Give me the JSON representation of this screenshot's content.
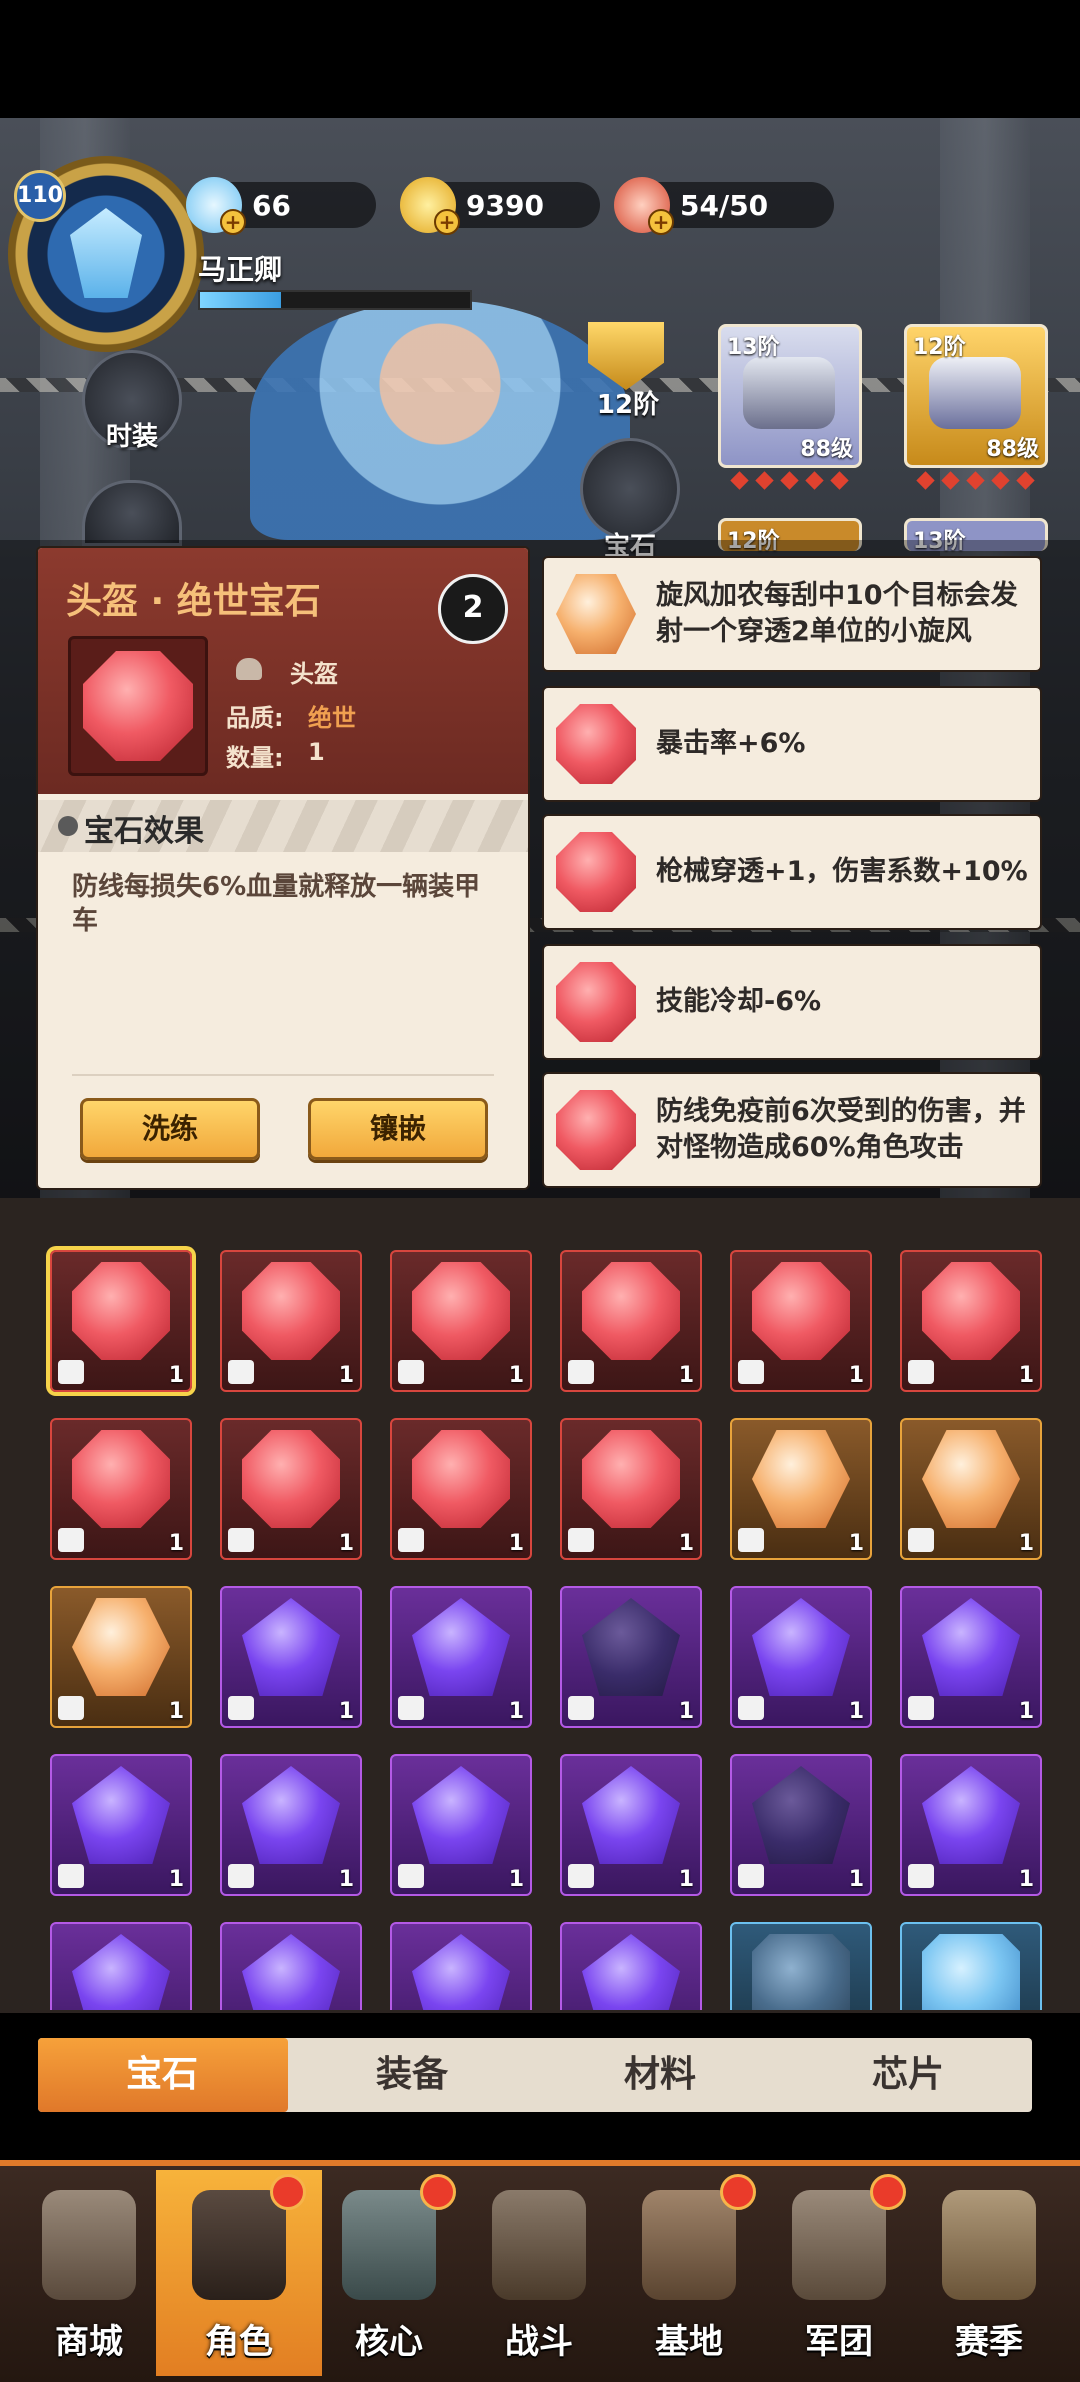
{
  "topbar": {
    "level": "110",
    "player_name": "马正卿",
    "diamonds": "66",
    "coins": "9390",
    "stamina": "54/50"
  },
  "side_buttons": [
    {
      "label": "时装",
      "icon": "outfit-icon"
    },
    {
      "label": "宝石",
      "icon": "list-icon"
    }
  ],
  "rank_badge": {
    "label": "12阶",
    "icon": "shield-rank-icon"
  },
  "equipment": [
    {
      "tier": "13阶",
      "level": "88级",
      "stars": 5,
      "icon": "helmet-equip-icon"
    },
    {
      "tier": "12阶",
      "level": "88级",
      "stars": 5,
      "icon": "armor-equip-icon"
    },
    {
      "tier": "12阶",
      "icon": "equip-icon"
    },
    {
      "tier": "13阶",
      "icon": "equip-icon"
    }
  ],
  "detail": {
    "title": "头盔 · 绝世宝石",
    "slot_label": "头盔",
    "quality_label": "品质:",
    "quality_value": "绝世",
    "count_label": "数量:",
    "count_value": "1",
    "effect_title": "宝石效果",
    "effect_text": "防线每损失6%血量就释放一辆装甲车",
    "btn_reroll": "洗练",
    "btn_inlay": "镶嵌",
    "lock_value": "2",
    "colors": {
      "header": "#8c3a2e",
      "title": "#f6c07a",
      "quality": "#f0a050"
    }
  },
  "effects": [
    {
      "text": "旋风加农每刮中10个目标会发射一个穿透2单位的小旋风",
      "gem": "orange"
    },
    {
      "text": "暴击率+6%",
      "gem": "red"
    },
    {
      "text": "枪械穿透+1，伤害系数+10%",
      "gem": "red"
    },
    {
      "text": "技能冷却-6%",
      "gem": "red"
    },
    {
      "text": "防线免疫前6次受到的伤害，并对怪物造成60%角色攻击",
      "gem": "red"
    }
  ],
  "inventory": [
    {
      "gem": "red",
      "slot": "helmet-icon",
      "count": "1",
      "selected": true
    },
    {
      "gem": "red",
      "slot": "helmet-icon",
      "count": "1"
    },
    {
      "gem": "red",
      "slot": "armor-icon",
      "count": "1"
    },
    {
      "gem": "red",
      "slot": "armor-icon",
      "count": "1"
    },
    {
      "gem": "red",
      "slot": "armor-icon",
      "count": "1"
    },
    {
      "gem": "red",
      "slot": "gun-icon",
      "count": "1"
    },
    {
      "gem": "red",
      "slot": "gun-icon",
      "count": "1"
    },
    {
      "gem": "red",
      "slot": "pants-icon",
      "count": "1"
    },
    {
      "gem": "red",
      "slot": "pants-icon",
      "count": "1"
    },
    {
      "gem": "red",
      "slot": "glove-icon",
      "count": "1"
    },
    {
      "gem": "orange",
      "slot": "armor-icon",
      "count": "1"
    },
    {
      "gem": "orange",
      "slot": "boot-icon",
      "count": "1"
    },
    {
      "gem": "orange",
      "slot": "gun-icon",
      "count": "1"
    },
    {
      "gem": "purple",
      "slot": "helmet-icon",
      "count": "1"
    },
    {
      "gem": "purple",
      "slot": "helmet-icon",
      "count": "1"
    },
    {
      "gem": "dark",
      "slot": "helmet-icon",
      "count": "1"
    },
    {
      "gem": "purple",
      "slot": "helmet-icon",
      "count": "1"
    },
    {
      "gem": "purple",
      "slot": "armor-icon",
      "count": "1"
    },
    {
      "gem": "purple",
      "slot": "boot-icon",
      "count": "1"
    },
    {
      "gem": "purple",
      "slot": "boot-icon",
      "count": "1"
    },
    {
      "gem": "purple",
      "slot": "boot-icon",
      "count": "1"
    },
    {
      "gem": "purple",
      "slot": "gun-icon",
      "count": "1"
    },
    {
      "gem": "dark",
      "slot": "gun-icon",
      "count": "1"
    },
    {
      "gem": "purple",
      "slot": "pants-icon",
      "count": "1"
    },
    {
      "gem": "purple",
      "slot": "",
      "count": ""
    },
    {
      "gem": "purple",
      "slot": "",
      "count": ""
    },
    {
      "gem": "purple",
      "slot": "",
      "count": ""
    },
    {
      "gem": "purple",
      "slot": "",
      "count": ""
    },
    {
      "gem": "slate",
      "slot": "",
      "count": ""
    },
    {
      "gem": "blue",
      "slot": "",
      "count": ""
    }
  ],
  "tabs": [
    {
      "label": "宝石",
      "active": true
    },
    {
      "label": "装备"
    },
    {
      "label": "材料"
    },
    {
      "label": "芯片"
    }
  ],
  "nav": [
    {
      "label": "商城",
      "icon": "shop-icon",
      "badge": false
    },
    {
      "label": "角色",
      "icon": "character-icon",
      "badge": true,
      "active": true
    },
    {
      "label": "核心",
      "icon": "core-icon",
      "badge": true
    },
    {
      "label": "战斗",
      "icon": "battle-icon",
      "badge": false
    },
    {
      "label": "基地",
      "icon": "base-icon",
      "badge": true
    },
    {
      "label": "军团",
      "icon": "legion-icon",
      "badge": true
    },
    {
      "label": "赛季",
      "icon": "season-icon",
      "badge": false
    }
  ]
}
